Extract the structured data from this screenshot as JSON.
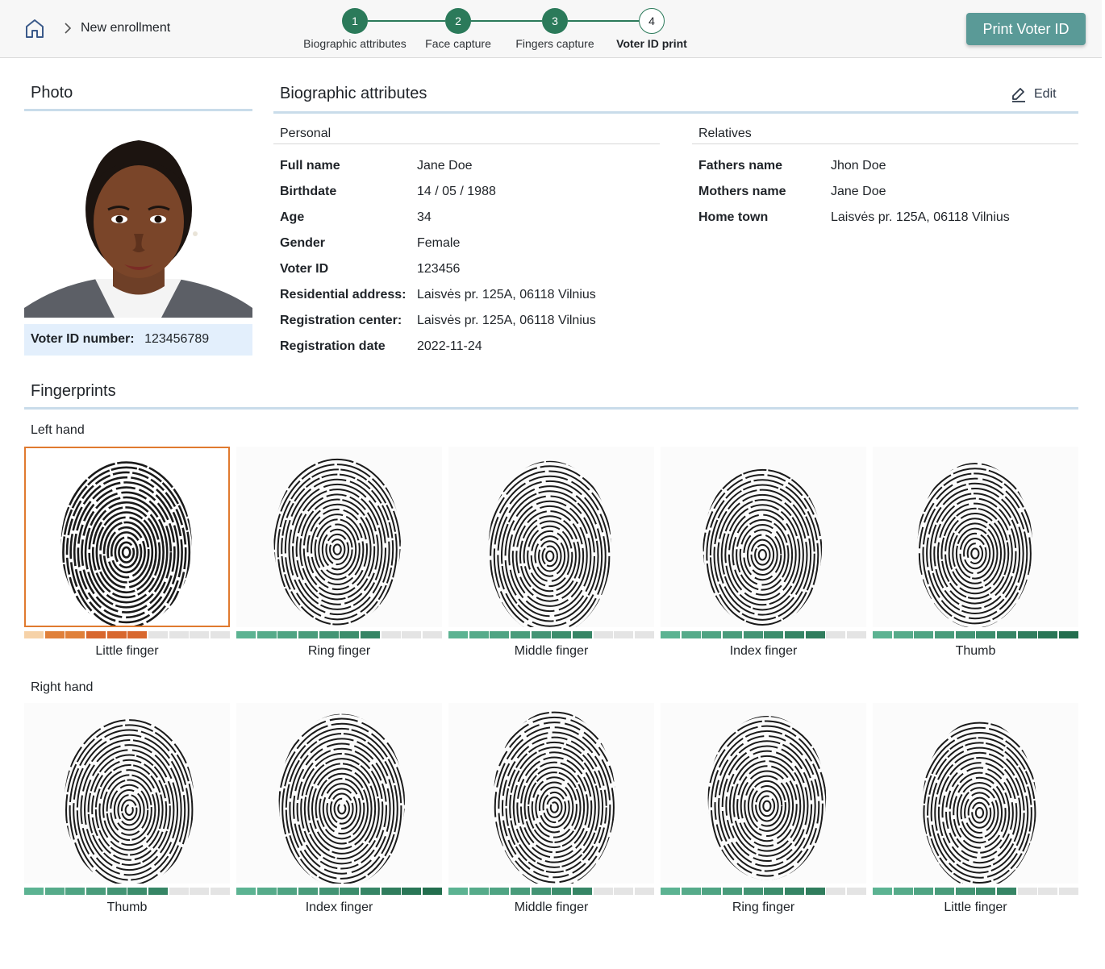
{
  "header": {
    "breadcrumb": "New enrollment",
    "steps": [
      {
        "number": "1",
        "label": "Biographic attributes",
        "done": true
      },
      {
        "number": "2",
        "label": "Face capture",
        "done": true
      },
      {
        "number": "3",
        "label": "Fingers capture",
        "done": true
      },
      {
        "number": "4",
        "label": "Voter ID print",
        "done": false
      }
    ],
    "print_button": "Print Voter ID"
  },
  "photo": {
    "title": "Photo",
    "voter_id_label": "Voter ID number:",
    "voter_id_value": "123456789"
  },
  "bio": {
    "title": "Biographic attributes",
    "edit_label": "Edit",
    "personal_title": "Personal",
    "personal": [
      {
        "key": "Full name",
        "value": "Jane Doe"
      },
      {
        "key": "Birthdate",
        "value": "14 / 05 / 1988"
      },
      {
        "key": "Age",
        "value": "34"
      },
      {
        "key": "Gender",
        "value": "Female"
      },
      {
        "key": "Voter ID",
        "value": "123456"
      },
      {
        "key": "Residential address:",
        "value": "Laisvės pr. 125A, 06118 Vilnius"
      },
      {
        "key": "Registration center:",
        "value": "Laisvės pr. 125A, 06118 Vilnius"
      },
      {
        "key": "Registration date",
        "value": "2022-11-24"
      }
    ],
    "relatives_title": "Relatives",
    "relatives": [
      {
        "key": "Fathers name",
        "value": "Jhon Doe"
      },
      {
        "key": "Mothers name",
        "value": "Jane Doe"
      },
      {
        "key": "Home town",
        "value": "Laisvės pr. 125A, 06118 Vilnius"
      }
    ]
  },
  "fingerprints": {
    "title": "Fingerprints",
    "left_hand_label": "Left hand",
    "right_hand_label": "Right hand",
    "left": [
      {
        "name": "Little finger",
        "quality_segments": 6,
        "status": "poor",
        "selected": true
      },
      {
        "name": "Ring finger",
        "quality_segments": 7,
        "status": "good",
        "selected": false
      },
      {
        "name": "Middle finger",
        "quality_segments": 7,
        "status": "good",
        "selected": false
      },
      {
        "name": "Index finger",
        "quality_segments": 8,
        "status": "good",
        "selected": false
      },
      {
        "name": "Thumb",
        "quality_segments": 10,
        "status": "good",
        "selected": false
      }
    ],
    "right": [
      {
        "name": "Thumb",
        "quality_segments": 7,
        "status": "good",
        "selected": false
      },
      {
        "name": "Index finger",
        "quality_segments": 10,
        "status": "good",
        "selected": false
      },
      {
        "name": "Middle finger",
        "quality_segments": 7,
        "status": "good",
        "selected": false
      },
      {
        "name": "Ring finger",
        "quality_segments": 8,
        "status": "good",
        "selected": false
      },
      {
        "name": "Little finger",
        "quality_segments": 7,
        "status": "good",
        "selected": false
      }
    ],
    "total_segments": 10
  },
  "colors": {
    "accent": "#2b7a5a",
    "button": "#5a9a97",
    "selected_border": "#e07a2f",
    "rule": "#c9dcea",
    "voter_box": "#e3effc"
  }
}
